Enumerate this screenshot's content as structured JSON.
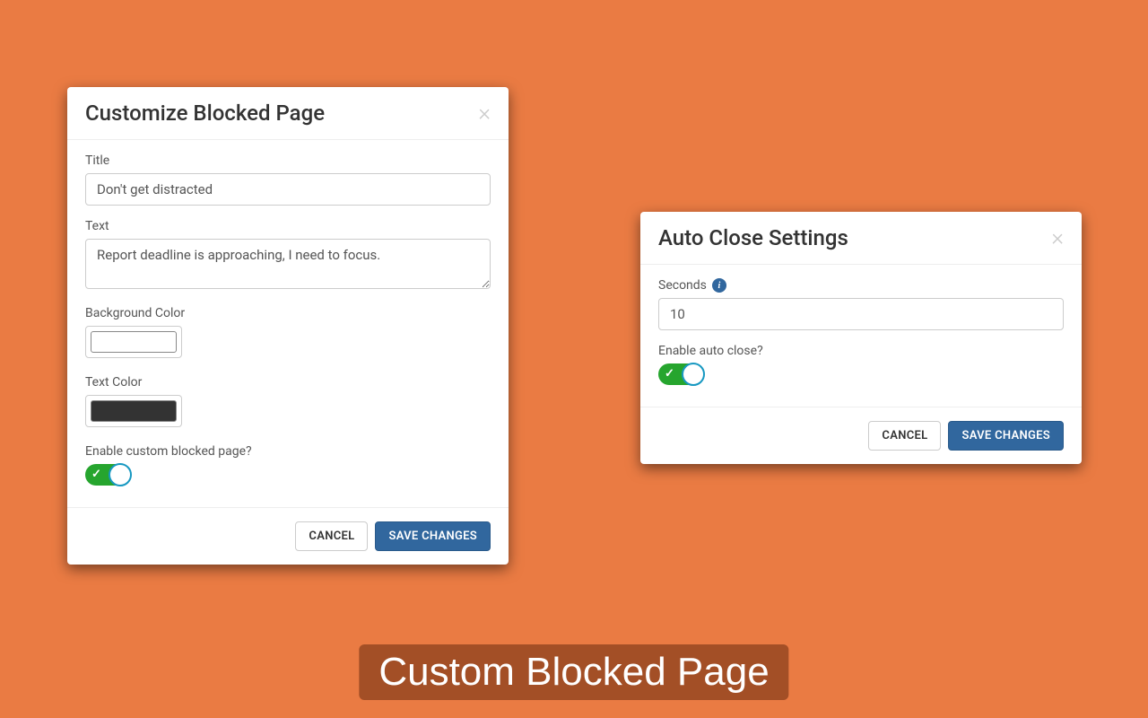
{
  "customize_modal": {
    "title": "Customize Blocked Page",
    "title_label": "Title",
    "title_value": "Don't get distracted",
    "text_label": "Text",
    "text_value": "Report deadline is approaching, I need to focus.",
    "bg_color_label": "Background Color",
    "bg_color_value": "#ffffff",
    "text_color_label": "Text Color",
    "text_color_value": "#333333",
    "enable_label": "Enable custom blocked page?",
    "enable_value": true,
    "cancel_label": "CANCEL",
    "save_label": "SAVE CHANGES"
  },
  "autoclose_modal": {
    "title": "Auto Close Settings",
    "seconds_label": "Seconds",
    "seconds_value": "10",
    "enable_label": "Enable auto close?",
    "enable_value": true,
    "cancel_label": "CANCEL",
    "save_label": "SAVE CHANGES"
  },
  "banner_text": "Custom Blocked Page"
}
